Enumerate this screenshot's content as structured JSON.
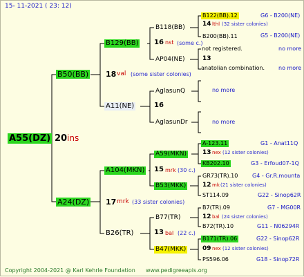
{
  "header": {
    "date": "15-  11-2021  (  23:  12)"
  },
  "footer": {
    "copyright": "Copyright 2004-2021 @ Karl Kehrle Foundation",
    "site": "www.pedigreeapis.org"
  },
  "root": {
    "name": "A55(DZ)",
    "num": "20",
    "ins": "ins"
  },
  "sire": {
    "name": "B50(BB)",
    "num": "18",
    "val": "val",
    "note": "(some sister colonies)"
  },
  "dam": {
    "name": "A24(DZ)",
    "num": "17",
    "mrk": "mrk",
    "note": "(33 sister colonies)"
  },
  "ss": {
    "name": "B129(BB)",
    "num": "16",
    "ins": "nst",
    "note": "(some c.)"
  },
  "sd": {
    "name": "A11(NE)",
    "num": "16"
  },
  "ds": {
    "name": "A104(MKN)",
    "num": "15",
    "mrk": "mrk",
    "note": "(30 c.)"
  },
  "dd": {
    "name": "B26(TR)",
    "num": "13",
    "bal": "bal",
    "note": "(22 c.)"
  },
  "g3": [
    {
      "name": "B118(BB)"
    },
    {
      "name": "AP04(NE)"
    },
    {
      "name": "AglasunQ"
    },
    {
      "name": "AglasunDr"
    },
    {
      "name": "A59(MKN)"
    },
    {
      "name": "B53(MKK)"
    },
    {
      "name": "B77(TR)"
    },
    {
      "name": "B47(MKK)"
    }
  ],
  "g4": [
    {
      "a": "B122(BB).12",
      "an": "",
      "b": "G6 - B200(NE)",
      "num": "14",
      "kind": "lthl",
      "note": "(32 sister colonies)",
      "c": "B200(BB).11",
      "d": "G5 - B200(NE)"
    },
    {
      "a": "not registered.",
      "b": "no more",
      "num": "13",
      "c": "anatolian combination.",
      "d": "no more"
    },
    {
      "a": "no more"
    },
    {
      "a": "no more"
    },
    {
      "a": "A-123.11",
      "b": "G1 - Anat11Q",
      "num": "13",
      "kind": "nex",
      "note": "(12 sister colonies)",
      "c": "KB202.10",
      "d": "G3 - Erfoud07-1Q"
    },
    {
      "a": "GR73(TR).10",
      "b": "G4 - Gr.R.mounta",
      "num": "12",
      "kind": "mk",
      "note": "(21 sister colonies)",
      "c": "ST114.09",
      "d": "G22 - Sinop62R"
    },
    {
      "a": "B7(TR).09",
      "b": "G7 - MG00R",
      "num": "12",
      "kind": "bal",
      "note": "(24 sister colonies)",
      "c": "B72(TR).10",
      "d": "G11 - N06294R"
    },
    {
      "a": "B171(TR).06",
      "b": "G22 - Sinop62R",
      "num": "09",
      "kind": "nex",
      "note": "(12 sister colonies)",
      "c": "PS596.06",
      "d": "G18 - Sinop72R"
    }
  ]
}
